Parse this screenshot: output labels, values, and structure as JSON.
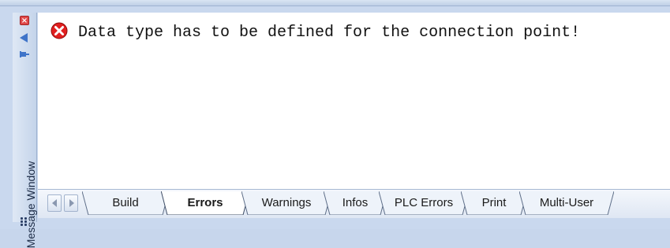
{
  "window": {
    "title": "Message Window",
    "colors": {
      "frame": "#c9d8ee",
      "content_bg": "#ffffff",
      "error_red": "#e02020"
    }
  },
  "sidebar": {
    "close_icon": "close-icon",
    "collapse_icon": "arrow-left-icon",
    "pin_icon": "pin-icon",
    "grip_icon": "grip-icon"
  },
  "messages": [
    {
      "type": "error",
      "icon": "error-icon",
      "text": "Data type has to be defined for the connection point!"
    }
  ],
  "tabs": [
    {
      "label": "Build",
      "active": false
    },
    {
      "label": "Errors",
      "active": true
    },
    {
      "label": "Warnings",
      "active": false
    },
    {
      "label": "Infos",
      "active": false
    },
    {
      "label": "PLC Errors",
      "active": false
    },
    {
      "label": "Print",
      "active": false
    },
    {
      "label": "Multi-User",
      "active": false
    }
  ]
}
